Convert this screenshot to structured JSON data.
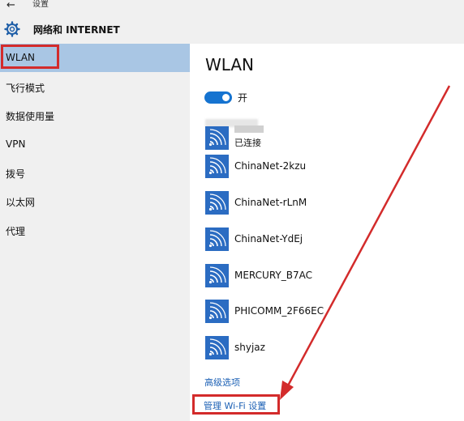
{
  "titlebar": {
    "title": "设置"
  },
  "header": {
    "title": "网络和 INTERNET"
  },
  "sidebar": {
    "items": [
      {
        "label": "WLAN"
      },
      {
        "label": "飞行模式"
      },
      {
        "label": "数据使用量"
      },
      {
        "label": "VPN"
      },
      {
        "label": "拨号"
      },
      {
        "label": "以太网"
      },
      {
        "label": "代理"
      }
    ],
    "active_index": 0
  },
  "main": {
    "title": "WLAN",
    "toggle": {
      "label": "开",
      "state": "on"
    },
    "connected_network": {
      "status": "已连接"
    },
    "networks": [
      {
        "name": "ChinaNet-2kzu"
      },
      {
        "name": "ChinaNet-rLnM"
      },
      {
        "name": "ChinaNet-YdEj"
      },
      {
        "name": "MERCURY_B7AC"
      },
      {
        "name": "PHICOMM_2F66EC"
      },
      {
        "name": "shyjaz"
      }
    ],
    "advanced_link": "高级选项",
    "manage_link": "管理 Wi-Fi 设置"
  },
  "colors": {
    "accent": "#1573d0",
    "annotation": "#d32b2b",
    "sidebar_selected": "#a9c6e4",
    "link": "#1a5fb4"
  }
}
